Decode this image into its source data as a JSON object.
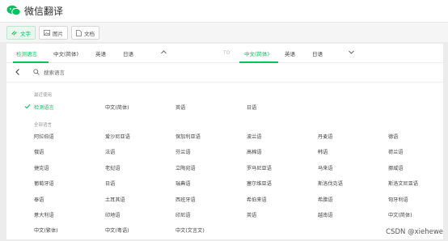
{
  "app": {
    "title": "微信翻译"
  },
  "toolbar": {
    "modes": [
      {
        "label": "文字",
        "icon": "text-icon",
        "active": true
      },
      {
        "label": "图片",
        "icon": "image-icon",
        "active": false
      },
      {
        "label": "文档",
        "icon": "document-icon",
        "active": false
      }
    ]
  },
  "source_tabs": [
    "检测语言",
    "中文(简体)",
    "英语",
    "日语"
  ],
  "target_tabs": [
    "中文(简体)",
    "英语",
    "日语"
  ],
  "swap_label": "TO",
  "search": {
    "placeholder": "搜索语言"
  },
  "recent": {
    "label": "最近使用",
    "items": [
      "检测语言",
      "中文(简体)",
      "英语",
      "日语"
    ],
    "selected": "检测语言"
  },
  "all": {
    "label": "全部语言",
    "items": [
      "阿拉伯语",
      "爱沙尼亚语",
      "保加利亚语",
      "波兰语",
      "丹麦语",
      "德语",
      "俄语",
      "法语",
      "芬兰语",
      "高棉语",
      "韩语",
      "荷兰语",
      "捷克语",
      "老挝语",
      "立陶宛语",
      "罗马尼亚语",
      "马来语",
      "挪威语",
      "葡萄牙语",
      "日语",
      "瑞典语",
      "塞尔维亚语",
      "斯洛伐克语",
      "斯洛文尼亚语",
      "泰语",
      "土耳其语",
      "西班牙语",
      "希伯来语",
      "希腊语",
      "匈牙利语",
      "意大利语",
      "印地语",
      "印尼语",
      "英语",
      "越南语",
      "中文(简体)",
      "中文(繁体)",
      "中文(粤语)",
      "中文(文言文)"
    ]
  },
  "watermark": "CSDN @xiehewe",
  "colors": {
    "accent": "#07c160"
  }
}
